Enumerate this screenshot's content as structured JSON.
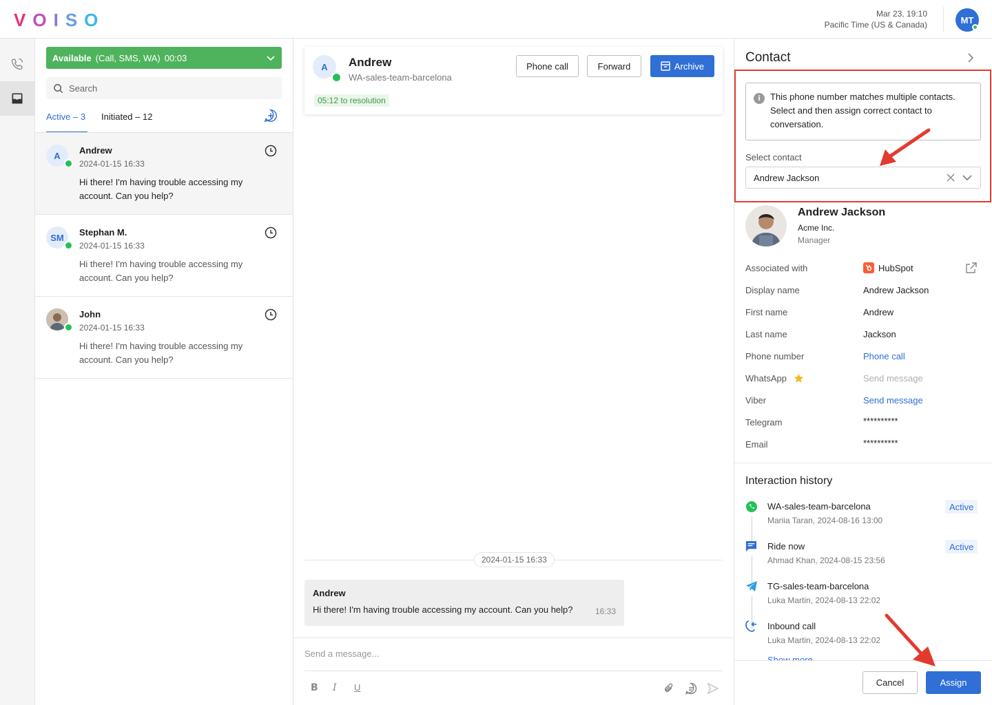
{
  "header": {
    "logo_letters": [
      "V",
      "O",
      "I",
      "S",
      "O"
    ],
    "date": "Mar 23, 19:10",
    "timezone": "Pacific Time (US & Canada)",
    "user_initials": "MT"
  },
  "colors": {
    "accent": "#2f6fd6",
    "status_green": "#4fb35d",
    "annotation_red": "#e23b2e"
  },
  "status_bar": {
    "label": "Available",
    "channels": "(Call, SMS, WA)",
    "timer": "00:03"
  },
  "search": {
    "placeholder": "Search"
  },
  "tabs": {
    "active": "Active – 3",
    "initiated": "Initiated – 12"
  },
  "conversations": [
    {
      "initials": "A",
      "name": "Andrew",
      "timestamp": "2024-01-15 16:33",
      "message": "Hi there! I'm having trouble accessing my account. Can you help?"
    },
    {
      "initials": "SM",
      "name": "Stephan M.",
      "timestamp": "2024-01-15 16:33",
      "message": "Hi there! I'm having trouble accessing my account. Can you help?"
    },
    {
      "initials": "",
      "name": "John",
      "timestamp": "2024-01-15 16:33",
      "message": "Hi there! I'm having trouble accessing my account. Can you help?"
    }
  ],
  "chat": {
    "initials": "A",
    "name": "Andrew",
    "channel": "WA-sales-team-barcelona",
    "resolution": "05:12 to resolution",
    "phone_call_btn": "Phone call",
    "forward_btn": "Forward",
    "archive_btn": "Archive",
    "date_divider": "2024-01-15 16:33",
    "message_author": "Andrew",
    "message_text": "Hi there! I'm having trouble accessing my account. Can you help?",
    "message_time": "16:33",
    "composer_placeholder": "Send a message...",
    "format_bold": "B",
    "format_italic": "I",
    "format_underline": "U"
  },
  "contact": {
    "title": "Contact",
    "info_text": "This phone number matches multiple contacts. Select and then assign correct contact to conversation.",
    "select_label": "Select contact",
    "selected_contact": "Andrew Jackson",
    "name": "Andrew Jackson",
    "company": "Acme Inc.",
    "role": "Manager",
    "fields": [
      {
        "label": "Associated with",
        "value": "HubSpot"
      },
      {
        "label": "Display name",
        "value": "Andrew Jackson"
      },
      {
        "label": "First name",
        "value": "Andrew"
      },
      {
        "label": "Last name",
        "value": "Jackson"
      },
      {
        "label": "Phone number",
        "value": "Phone call"
      },
      {
        "label": "WhatsApp",
        "value": "Send message"
      },
      {
        "label": "Viber",
        "value": "Send message"
      },
      {
        "label": "Telegram",
        "value": "**********"
      },
      {
        "label": "Email",
        "value": "**********"
      }
    ],
    "history_title": "Interaction history",
    "history": [
      {
        "icon": "whatsapp-icon",
        "name": "WA-sales-team-barcelona",
        "sub": "Mariia Taran, 2024-08-16 13:00",
        "badge": "Active"
      },
      {
        "icon": "sms-icon",
        "name": "Ride now",
        "sub": "Ahmad Khan, 2024-08-15 23:56",
        "badge": "Active"
      },
      {
        "icon": "telegram-icon",
        "name": "TG-sales-team-barcelona",
        "sub": "Luka Martin, 2024-08-13 22:02",
        "badge": ""
      },
      {
        "icon": "inbound-call-icon",
        "name": "Inbound call",
        "sub": "Luka Martin, 2024-08-13 22:02",
        "badge": ""
      }
    ],
    "show_more": "Show more",
    "cancel_btn": "Cancel",
    "assign_btn": "Assign"
  }
}
